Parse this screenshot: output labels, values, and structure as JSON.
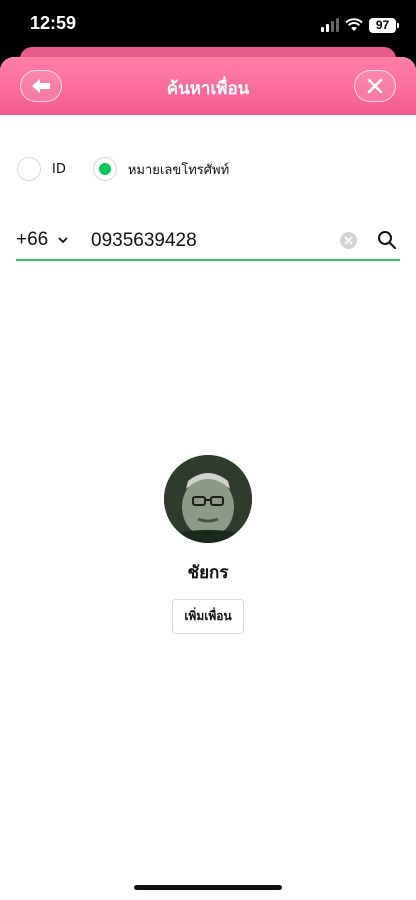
{
  "status_bar": {
    "time": "12:59",
    "battery": "97"
  },
  "header": {
    "title": "ค้นหาเพื่อน",
    "back_icon": "arrow-left-icon",
    "close_icon": "close-icon",
    "accent_color": "#f45d91"
  },
  "search_type": {
    "options": [
      {
        "label": "ID",
        "selected": false
      },
      {
        "label": "หมายเลขโทรศัพท์",
        "selected": true
      }
    ],
    "selected_color": "#06c755"
  },
  "phone_search": {
    "country_code": "+66",
    "value": "0935639428",
    "underline_color": "#3cbf6a"
  },
  "result": {
    "name": "ชัยกร",
    "add_friend_label": "เพิ่มเพื่อน"
  }
}
